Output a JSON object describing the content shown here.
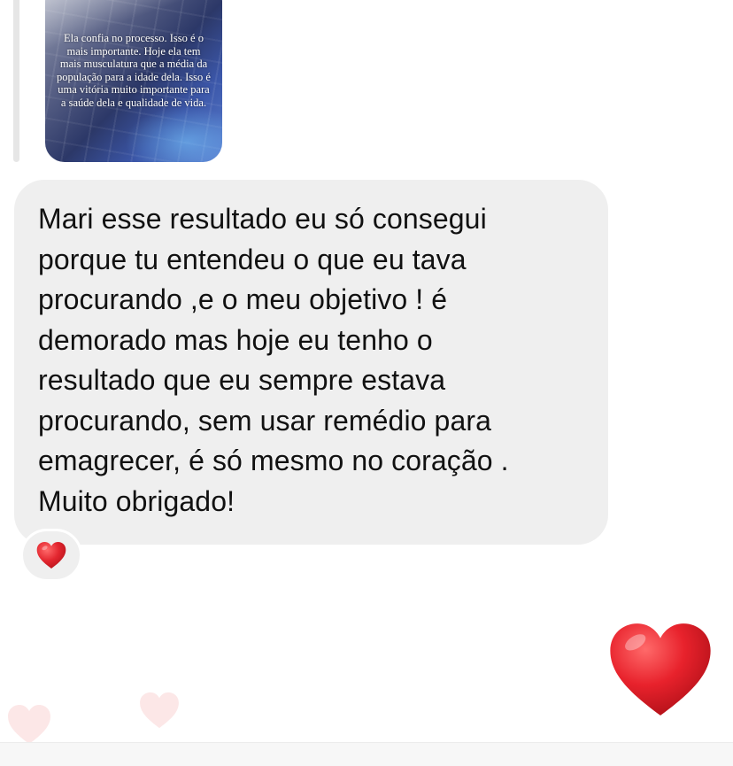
{
  "story": {
    "text": "Ela confia no processo. Isso é o mais importante. Hoje ela tem mais musculatura que a média da população para a idade dela. Isso é uma vitória muito importante para a saúde dela e qualidade de vida."
  },
  "message": {
    "text": "Mari esse resultado eu só consegui\nporque tu entendeu o que eu tava\nprocurando ,e o meu objetivo ! é\ndemorado mas hoje eu tenho o\nresultado que eu sempre estava\nprocurando, sem usar remédio para\nemagrecer,  é só mesmo no coração .\nMuito obrigado!"
  },
  "reaction": {
    "icon": "red-heart-icon"
  },
  "sent_reaction": {
    "icon": "red-heart-icon"
  },
  "colors": {
    "bubble": "#efefef",
    "heart": "#e3262f",
    "text": "#111111"
  }
}
